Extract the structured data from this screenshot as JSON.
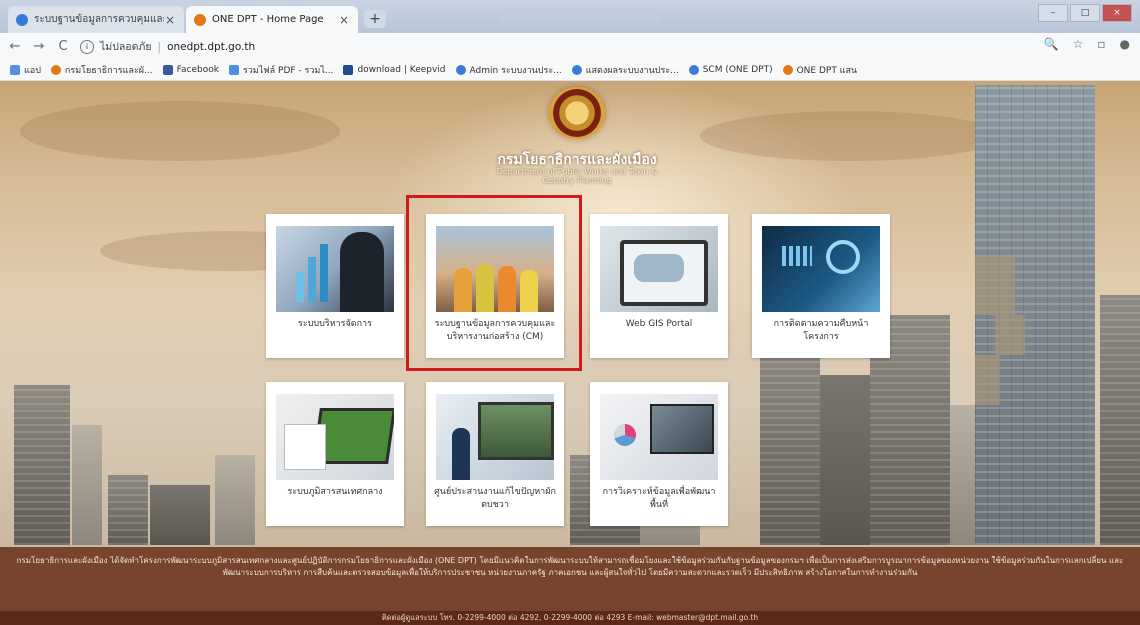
{
  "browser": {
    "tabs": [
      {
        "title": "ระบบฐานข้อมูลการควบคุมและบริห",
        "active": false,
        "favicon_color": "#3b7bd8"
      },
      {
        "title": "ONE DPT - Home Page",
        "active": true,
        "favicon_color": "#e27b16"
      }
    ],
    "new_tab": "+",
    "close": "×",
    "window_controls": [
      "–",
      "□",
      "×"
    ]
  },
  "toolbar": {
    "back": "←",
    "forward": "→",
    "reload": "C",
    "info": "i",
    "security_text": "ไม่ปลอดภัย",
    "url": "onedpt.dpt.go.th",
    "zoom": "🔍",
    "star": "☆",
    "ext": "▫",
    "profile": "●"
  },
  "bookmarks": [
    {
      "label": "แอป",
      "color": "#5a8de0"
    },
    {
      "label": "กรมโยธาธิการและผั...",
      "color": "#e27b16"
    },
    {
      "label": "Facebook",
      "color": "#3b5998"
    },
    {
      "label": "รวมไฟล์ PDF - รวมไ...",
      "color": "#4a90e2"
    },
    {
      "label": "download | Keepvid",
      "color": "#1f4e8c"
    },
    {
      "label": "Admin ระบบงานประ...",
      "color": "#3b7bd8"
    },
    {
      "label": "แสดงผลระบบงานประ...",
      "color": "#3b7bd8"
    },
    {
      "label": "SCM (ONE DPT)",
      "color": "#3b7bd8"
    },
    {
      "label": "ONE DPT แสน",
      "color": "#e27b16"
    }
  ],
  "header": {
    "org_name": "กรมโยธาธิการและผังเมือง",
    "org_sub": "Department of Public Works and Town & Country Planning"
  },
  "cards": [
    {
      "label": "ระบบบริหารจัดการ"
    },
    {
      "label": "ระบบฐานข้อมูลการควบคุมและบริหารงานก่อสร้าง (CM)"
    },
    {
      "label": "Web GIS Portal"
    },
    {
      "label": "การติดตามความคืบหน้าโครงการ"
    },
    {
      "label": "ระบบภูมิสารสนเทศกลาง"
    },
    {
      "label": "ศูนย์ประสานงานแก้ไขปัญหาผักตบชวา"
    },
    {
      "label": "การวิเคราะห์ข้อมูลเพื่อพัฒนาพื้นที่"
    }
  ],
  "footer": {
    "text": "กรมโยธาธิการและผังเมือง ได้จัดทำโครงการพัฒนาระบบภูมิสารสนเทศกลางและศูนย์ปฏิบัติการกรมโยธาธิการและผังเมือง (ONE DPT) โดยมีแนวคิดในการพัฒนาระบบให้สามารถเชื่อมโยงและใช้ข้อมูลร่วมกันกับฐานข้อมูลของกรมฯ เพื่อเป็นการส่งเสริมการบูรณาการข้อมูลของหน่วยงาน ใช้ข้อมูลร่วมกันในการแลกเปลี่ยน และพัฒนาระบบการบริหาร การสืบค้นและตรวจสอบข้อมูลเพื่อให้บริการประชาชน หน่วยงานภาครัฐ ภาคเอกชน และผู้สนใจทั่วไป โดยมีความสะดวกและรวดเร็ว มีประสิทธิภาพ สร้างโอกาสในการทำงานร่วมกัน",
    "contact": "ติดต่อผู้ดูแลระบบ โทร. 0-2299-4000 ต่อ 4292, 0-2299-4000 ต่อ 4293 E-mail: webmaster@dpt.mail.go.th"
  },
  "colors": {
    "highlight": "#d11a1a",
    "footer": "#6b341e"
  }
}
